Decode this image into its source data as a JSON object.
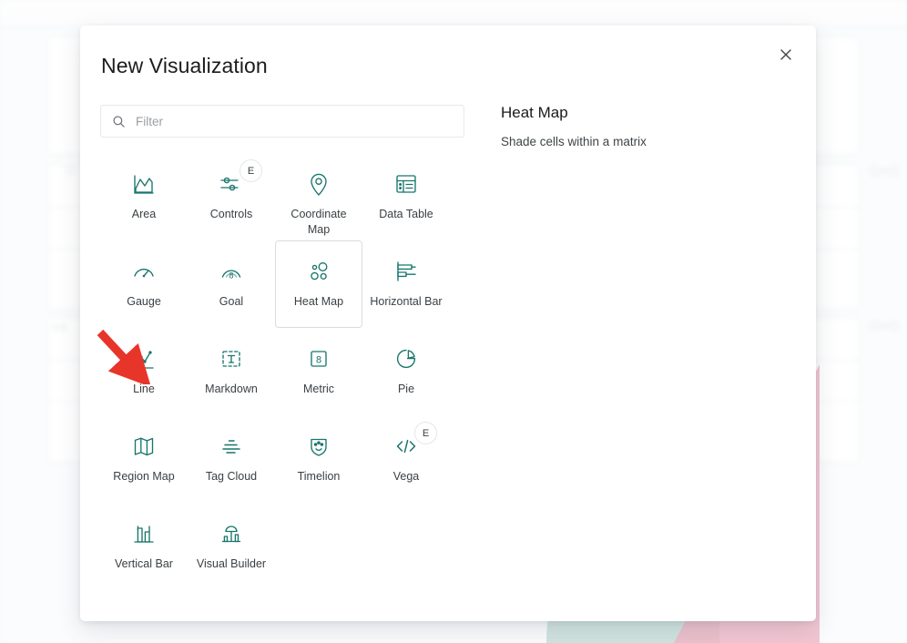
{
  "modal": {
    "title": "New Visualization",
    "close_label": "Close",
    "close_icon": "close-icon"
  },
  "search": {
    "placeholder": "Filter",
    "value": "",
    "icon": "search-icon"
  },
  "types": [
    {
      "label": "Area",
      "icon": "area-chart-icon",
      "badge": null,
      "selected": false
    },
    {
      "label": "Controls",
      "icon": "controls-icon",
      "badge": "E",
      "selected": false
    },
    {
      "label": "Coordinate Map",
      "icon": "map-pin-icon",
      "badge": null,
      "selected": false
    },
    {
      "label": "Data Table",
      "icon": "data-table-icon",
      "badge": null,
      "selected": false
    },
    {
      "label": "Gauge",
      "icon": "gauge-icon",
      "badge": null,
      "selected": false
    },
    {
      "label": "Goal",
      "icon": "goal-icon",
      "badge": null,
      "selected": false
    },
    {
      "label": "Heat Map",
      "icon": "heat-map-icon",
      "badge": null,
      "selected": true
    },
    {
      "label": "Horizontal Bar",
      "icon": "horizontal-bar-icon",
      "badge": null,
      "selected": false
    },
    {
      "label": "Line",
      "icon": "line-chart-icon",
      "badge": null,
      "selected": false
    },
    {
      "label": "Markdown",
      "icon": "markdown-icon",
      "badge": null,
      "selected": false
    },
    {
      "label": "Metric",
      "icon": "metric-icon",
      "badge": null,
      "selected": false
    },
    {
      "label": "Pie",
      "icon": "pie-chart-icon",
      "badge": null,
      "selected": false
    },
    {
      "label": "Region Map",
      "icon": "region-map-icon",
      "badge": null,
      "selected": false
    },
    {
      "label": "Tag Cloud",
      "icon": "tag-cloud-icon",
      "badge": null,
      "selected": false
    },
    {
      "label": "Timelion",
      "icon": "timelion-icon",
      "badge": null,
      "selected": false
    },
    {
      "label": "Vega",
      "icon": "vega-icon",
      "badge": "E",
      "selected": false
    },
    {
      "label": "Vertical Bar",
      "icon": "vertical-bar-icon",
      "badge": null,
      "selected": false
    },
    {
      "label": "Visual Builder",
      "icon": "visual-builder-icon",
      "badge": null,
      "selected": false
    }
  ],
  "details": {
    "title": "Heat Map",
    "description": "Shade cells within a matrix"
  },
  "background": {
    "metric_left_1": "0 It",
    "metric_right_1": "0 – 0",
    "metric_right_2": "0 – 0"
  },
  "colors": {
    "icon_teal": "#17766c",
    "title_text": "#1a1c1d",
    "body_text": "#3f4447",
    "border": "#e6eaed",
    "selected_border": "#d8dde1",
    "annotation_red": "#e8352a",
    "decor_pink": "#f0b9c9",
    "decor_teal": "#cfe3dd"
  },
  "annotation": {
    "shape": "arrow",
    "color": "#e8352a",
    "points_to": "Line"
  }
}
